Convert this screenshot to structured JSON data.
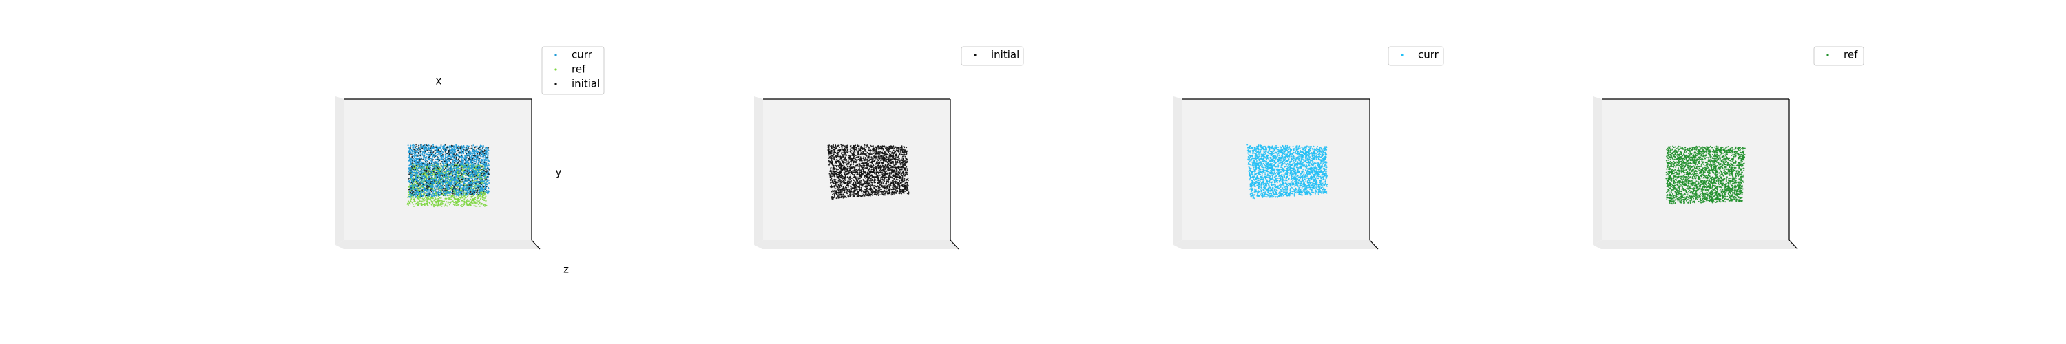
{
  "chart_data": [
    {
      "type": "scatter",
      "projection": "3d",
      "xlabel": "x",
      "ylabel": "y",
      "zlabel": "z",
      "grid": false,
      "legend_placement": "top-right",
      "series": [
        {
          "name": "curr",
          "color": "#1f9ad6"
        },
        {
          "name": "ref",
          "color": "#7dd63f"
        },
        {
          "name": "initial",
          "color": "#111111"
        }
      ]
    },
    {
      "type": "scatter",
      "projection": "3d",
      "grid": false,
      "legend_placement": "top-right",
      "series": [
        {
          "name": "initial",
          "color": "#111111"
        }
      ]
    },
    {
      "type": "scatter",
      "projection": "3d",
      "grid": false,
      "legend_placement": "top-right",
      "series": [
        {
          "name": "curr",
          "color": "#22bff5"
        }
      ]
    },
    {
      "type": "scatter",
      "projection": "3d",
      "grid": false,
      "legend_placement": "top-right",
      "series": [
        {
          "name": "ref",
          "color": "#1f8f2a"
        }
      ]
    }
  ],
  "colors": {
    "pane": "#f2f2f2",
    "pane_side": "#ebebeb",
    "axis_line": "#000000",
    "legend_border": "#cccccc"
  }
}
